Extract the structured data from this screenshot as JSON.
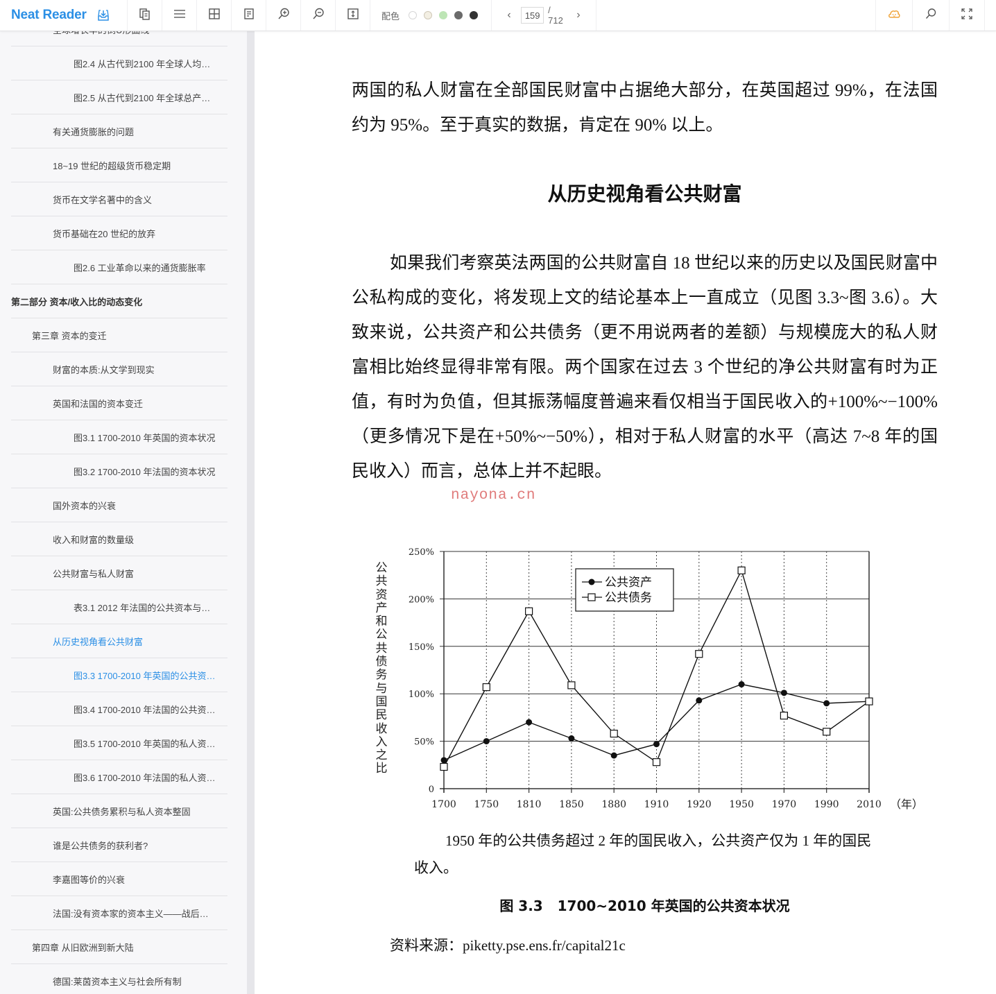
{
  "app": {
    "name": "Neat Reader"
  },
  "toolbar": {
    "theme_label": "配色",
    "theme_colors": [
      "#ffffff",
      "#f3efe3",
      "#bde5b5",
      "#6b6b6b",
      "#333333"
    ],
    "current_page": "159",
    "total_pages": "/ 712",
    "brand_color": "#2b8fe5",
    "cloud_color": "#f0a43a",
    "icons": [
      "save-to-library-icon",
      "copy-book-icon",
      "toc-list-icon",
      "grid-view-icon",
      "notes-icon",
      "zoom-in-icon",
      "zoom-out-icon",
      "fit-height-icon",
      "cloud-sync-icon",
      "search-icon",
      "fullscreen-icon"
    ]
  },
  "sidebar": {
    "items": [
      {
        "label": "全球增长率的倒U形曲线",
        "level": 2,
        "active": false
      },
      {
        "label": "图2.4 从古代到2100 年全球人均…",
        "level": 3,
        "active": false
      },
      {
        "label": "图2.5 从古代到2100 年全球总产…",
        "level": 3,
        "active": false
      },
      {
        "label": "有关通货膨胀的问题",
        "level": 2,
        "active": false
      },
      {
        "label": "18~19 世纪的超级货币稳定期",
        "level": 2,
        "active": false
      },
      {
        "label": "货币在文学名著中的含义",
        "level": 2,
        "active": false
      },
      {
        "label": "货币基础在20 世纪的放弃",
        "level": 2,
        "active": false
      },
      {
        "label": "图2.6 工业革命以来的通货膨胀率",
        "level": 3,
        "active": false
      },
      {
        "label": "第二部分 资本/收入比的动态变化",
        "level": 0,
        "active": false
      },
      {
        "label": "第三章 资本的变迁",
        "level": 1,
        "active": false
      },
      {
        "label": "财富的本质:从文学到现实",
        "level": 2,
        "active": false
      },
      {
        "label": "英国和法国的资本变迁",
        "level": 2,
        "active": false
      },
      {
        "label": "图3.1 1700-2010 年英国的资本状况",
        "level": 3,
        "active": false
      },
      {
        "label": "图3.2 1700-2010 年法国的资本状况",
        "level": 3,
        "active": false
      },
      {
        "label": "国外资本的兴衰",
        "level": 2,
        "active": false
      },
      {
        "label": "收入和财富的数量级",
        "level": 2,
        "active": false
      },
      {
        "label": "公共财富与私人财富",
        "level": 2,
        "active": false
      },
      {
        "label": "表3.1 2012 年法国的公共资本与…",
        "level": 3,
        "active": false
      },
      {
        "label": "从历史视角看公共财富",
        "level": 2,
        "active": true
      },
      {
        "label": "图3.3 1700-2010 年英国的公共资…",
        "level": 3,
        "active": true
      },
      {
        "label": "图3.4 1700-2010 年法国的公共资…",
        "level": 3,
        "active": false
      },
      {
        "label": "图3.5 1700-2010 年英国的私人资…",
        "level": 3,
        "active": false
      },
      {
        "label": "图3.6 1700-2010 年法国的私人资…",
        "level": 3,
        "active": false
      },
      {
        "label": "英国:公共债务累积与私人资本整固",
        "level": 2,
        "active": false
      },
      {
        "label": "谁是公共债务的获利者?",
        "level": 2,
        "active": false
      },
      {
        "label": "李嘉图等价的兴衰",
        "level": 2,
        "active": false
      },
      {
        "label": "法国:没有资本家的资本主义——战后…",
        "level": 2,
        "active": false
      },
      {
        "label": "第四章 从旧欧洲到新大陆",
        "level": 1,
        "active": false
      },
      {
        "label": "德国:莱茵资本主义与社会所有制",
        "level": 2,
        "active": false
      }
    ]
  },
  "content": {
    "paragraph1": "两国的私人财富在全部国民财富中占据绝大部分，在英国超过 99%，在法国约为 95%。至于真实的数据，肯定在 90% 以上。",
    "heading": "从历史视角看公共财富",
    "paragraph2": "如果我们考察英法两国的公共财富自 18 世纪以来的历史以及国民财富中公私构成的变化，将发现上文的结论基本上一直成立（见图 3.3~图 3.6）。大致来说，公共资产和公共债务（更不用说两者的差额）与规模庞大的私人财富相比始终显得非常有限。两个国家在过去 3 个世纪的净公共财富有时为正值，有时为负值，但其振荡幅度普遍来看仅相当于国民收入的+100%~−100%（更多情况下是在+50%~−50%），相对于私人财富的水平（高达 7~8 年的国民收入）而言，总体上并不起眼。",
    "watermark": "nayona.cn",
    "chart_note": "1950 年的公共债务超过 2 年的国民收入，公共资产仅为 1 年的国民收入。",
    "figure_caption": "图 3.3   1700~2010 年英国的公共资本状况",
    "source": "资料来源：piketty.pse.ens.fr/capital21c"
  },
  "chart_data": {
    "type": "line",
    "title": "图 3.3 1700~2010 年英国的公共资本状况",
    "xlabel": "（年）",
    "ylabel": "公共资产和公共债务与国民收入之比",
    "categories": [
      "1700",
      "1750",
      "1810",
      "1850",
      "1880",
      "1910",
      "1920",
      "1950",
      "1970",
      "1990",
      "2010"
    ],
    "y_ticks": [
      "0",
      "50%",
      "100%",
      "150%",
      "200%",
      "250%"
    ],
    "ylim": [
      0,
      250
    ],
    "grid": true,
    "legend_position": "top-center",
    "series": [
      {
        "name": "公共资产",
        "marker": "filled-circle",
        "values": [
          30,
          50,
          70,
          53,
          35,
          47,
          93,
          110,
          101,
          90,
          92
        ]
      },
      {
        "name": "公共债务",
        "marker": "open-square",
        "values": [
          23,
          107,
          187,
          109,
          58,
          28,
          142,
          230,
          77,
          60,
          92
        ]
      }
    ]
  }
}
